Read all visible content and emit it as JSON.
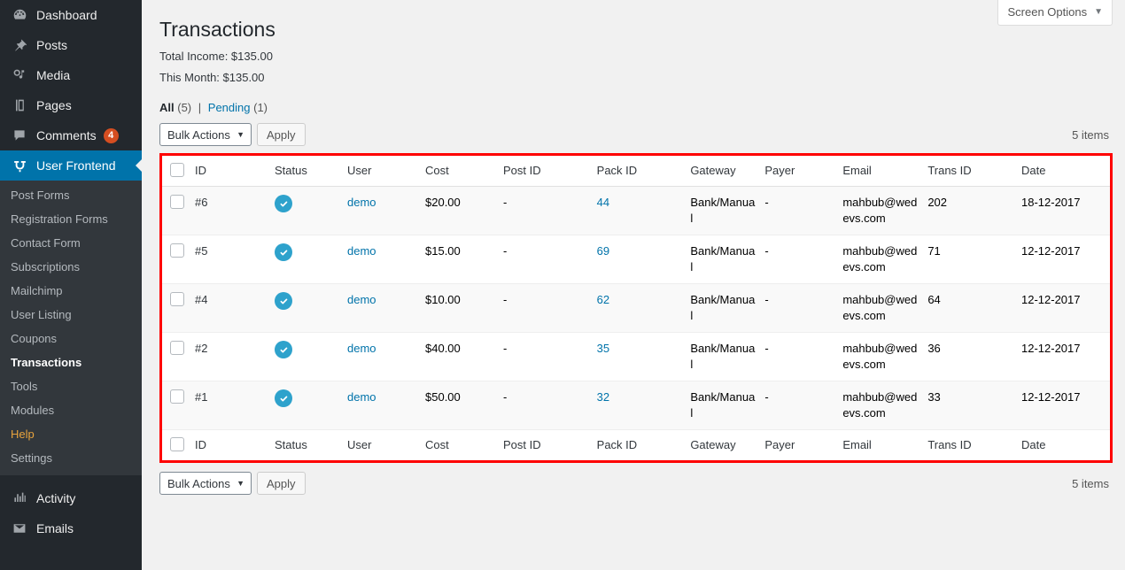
{
  "sidebar": {
    "items": [
      {
        "label": "Dashboard",
        "icon": "dashboard-icon",
        "badge": null
      },
      {
        "label": "Posts",
        "icon": "pin-icon",
        "badge": null
      },
      {
        "label": "Media",
        "icon": "media-icon",
        "badge": null
      },
      {
        "label": "Pages",
        "icon": "pages-icon",
        "badge": null
      },
      {
        "label": "Comments",
        "icon": "comments-icon",
        "badge": "4"
      },
      {
        "label": "User Frontend",
        "icon": "user-frontend-icon",
        "badge": null
      }
    ],
    "submenu": [
      {
        "label": "Post Forms"
      },
      {
        "label": "Registration Forms"
      },
      {
        "label": "Contact Form"
      },
      {
        "label": "Subscriptions"
      },
      {
        "label": "Mailchimp"
      },
      {
        "label": "User Listing"
      },
      {
        "label": "Coupons"
      },
      {
        "label": "Transactions"
      },
      {
        "label": "Tools"
      },
      {
        "label": "Modules"
      },
      {
        "label": "Help"
      },
      {
        "label": "Settings"
      }
    ],
    "bottom_items": [
      {
        "label": "Activity",
        "icon": "activity-chart-icon"
      },
      {
        "label": "Emails",
        "icon": "envelope-icon"
      }
    ],
    "active_item": "User Frontend",
    "current_submenu": "Transactions",
    "accent_color": "#0073aa",
    "badge_color": "#d54e21",
    "help_color": "#e8a33d"
  },
  "screen_options": {
    "label": "Screen Options",
    "caret": "▼"
  },
  "page": {
    "title": "Transactions",
    "total_income_label": "Total Income: $135.00",
    "this_month_label": "This Month: $135.00"
  },
  "views": {
    "all_label": "All",
    "all_count": "(5)",
    "separator": "|",
    "pending_label": "Pending",
    "pending_count": "(1)"
  },
  "tablenav_top": {
    "bulk_actions_label": "Bulk Actions",
    "caret": "▼",
    "apply_label": "Apply",
    "items_count": "5 items"
  },
  "tablenav_bottom": {
    "bulk_actions_label": "Bulk Actions",
    "caret": "▼",
    "apply_label": "Apply",
    "items_count": "5 items"
  },
  "table": {
    "highlight_color": "#fe0000",
    "columns": [
      {
        "key": "id",
        "label": "ID",
        "sortable": true
      },
      {
        "key": "status",
        "label": "Status",
        "sortable": true
      },
      {
        "key": "user",
        "label": "User",
        "sortable": false
      },
      {
        "key": "cost",
        "label": "Cost",
        "sortable": false
      },
      {
        "key": "post_id",
        "label": "Post ID",
        "sortable": false
      },
      {
        "key": "pack_id",
        "label": "Pack ID",
        "sortable": false
      },
      {
        "key": "gateway",
        "label": "Gateway",
        "sortable": false
      },
      {
        "key": "payer",
        "label": "Payer",
        "sortable": false
      },
      {
        "key": "email",
        "label": "Email",
        "sortable": false
      },
      {
        "key": "trans_id",
        "label": "Trans ID",
        "sortable": false
      },
      {
        "key": "date",
        "label": "Date",
        "sortable": true
      }
    ],
    "rows": [
      {
        "id": "#6",
        "status_icon": "check-circle-icon",
        "user": "demo",
        "cost": "$20.00",
        "post_id": "-",
        "pack_id": "44",
        "gateway": "Bank/Manual",
        "payer": "-",
        "email": "mahbub@wedevs.com",
        "trans_id": "202",
        "date": "18-12-2017"
      },
      {
        "id": "#5",
        "status_icon": "check-circle-icon",
        "user": "demo",
        "cost": "$15.00",
        "post_id": "-",
        "pack_id": "69",
        "gateway": "Bank/Manual",
        "payer": "-",
        "email": "mahbub@wedevs.com",
        "trans_id": "71",
        "date": "12-12-2017"
      },
      {
        "id": "#4",
        "status_icon": "check-circle-icon",
        "user": "demo",
        "cost": "$10.00",
        "post_id": "-",
        "pack_id": "62",
        "gateway": "Bank/Manual",
        "payer": "-",
        "email": "mahbub@wedevs.com",
        "trans_id": "64",
        "date": "12-12-2017"
      },
      {
        "id": "#2",
        "status_icon": "check-circle-icon",
        "user": "demo",
        "cost": "$40.00",
        "post_id": "-",
        "pack_id": "35",
        "gateway": "Bank/Manual",
        "payer": "-",
        "email": "mahbub@wedevs.com",
        "trans_id": "36",
        "date": "12-12-2017"
      },
      {
        "id": "#1",
        "status_icon": "check-circle-icon",
        "user": "demo",
        "cost": "$50.00",
        "post_id": "-",
        "pack_id": "32",
        "gateway": "Bank/Manual",
        "payer": "-",
        "email": "mahbub@wedevs.com",
        "trans_id": "33",
        "date": "12-12-2017"
      }
    ]
  }
}
